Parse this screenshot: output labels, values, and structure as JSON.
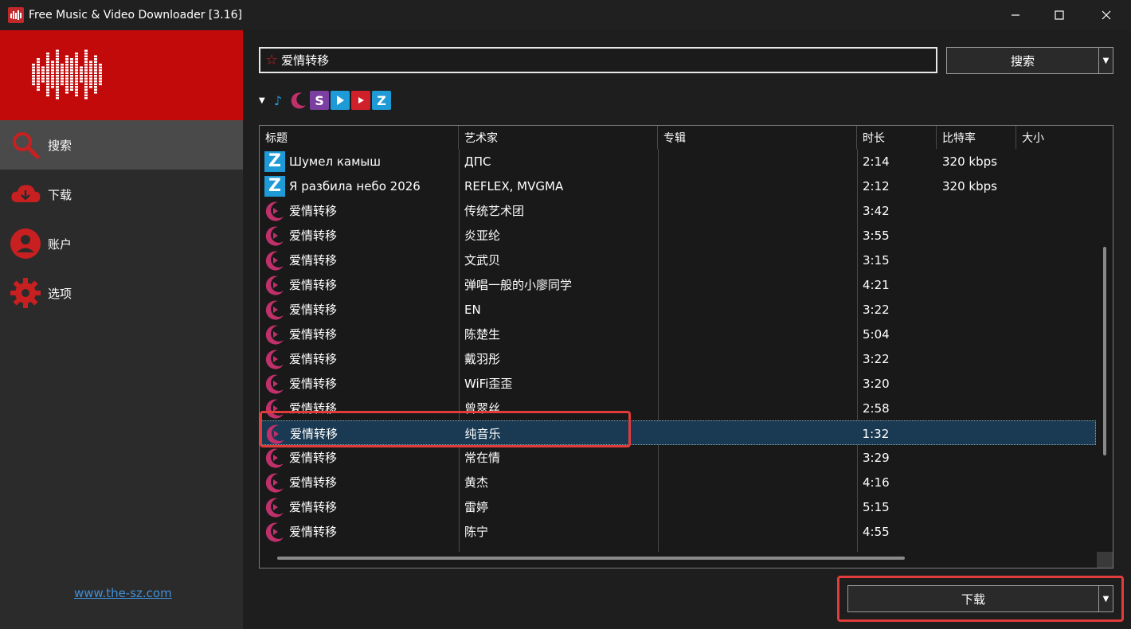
{
  "window": {
    "title": "Free Music & Video Downloader [3.16]",
    "minimize": "—",
    "maximize": "☐",
    "close": "✕"
  },
  "sidebar": {
    "items": [
      {
        "label": "搜索",
        "icon": "search-icon",
        "active": true
      },
      {
        "label": "下载",
        "icon": "cloud-download-icon",
        "active": false
      },
      {
        "label": "账户",
        "icon": "user-icon",
        "active": false
      },
      {
        "label": "选项",
        "icon": "gear-icon",
        "active": false
      }
    ],
    "link": "www.the-sz.com"
  },
  "search": {
    "query": "爱情转移",
    "button_label": "搜索"
  },
  "sources": [
    "music-note-icon",
    "moon-icon",
    "s-icon",
    "play-icon",
    "youtube-icon",
    "z-icon"
  ],
  "table": {
    "headers": [
      "标题",
      "艺术家",
      "专辑",
      "时长",
      "比特率",
      "大小"
    ],
    "rows": [
      {
        "icon": "z",
        "title": "Шумел камыш",
        "artist": "ДПС",
        "album": "",
        "duration": "2:14",
        "bitrate": "320 kbps",
        "size": ""
      },
      {
        "icon": "z",
        "title": "Я разбила небо 2026",
        "artist": "REFLEX, MVGMA",
        "album": "",
        "duration": "2:12",
        "bitrate": "320 kbps",
        "size": ""
      },
      {
        "icon": "moon",
        "title": "爱情转移",
        "artist": "传统艺术团",
        "album": "",
        "duration": "3:42",
        "bitrate": "",
        "size": ""
      },
      {
        "icon": "moon",
        "title": "爱情转移",
        "artist": "炎亚纶",
        "album": "",
        "duration": "3:55",
        "bitrate": "",
        "size": ""
      },
      {
        "icon": "moon",
        "title": "爱情转移",
        "artist": "文武贝",
        "album": "",
        "duration": "3:15",
        "bitrate": "",
        "size": ""
      },
      {
        "icon": "moon",
        "title": "爱情转移",
        "artist": "弹唱一般的小廖同学",
        "album": "",
        "duration": "4:21",
        "bitrate": "",
        "size": ""
      },
      {
        "icon": "moon",
        "title": "爱情转移",
        "artist": "EN",
        "album": "",
        "duration": "3:22",
        "bitrate": "",
        "size": ""
      },
      {
        "icon": "moon",
        "title": "爱情转移",
        "artist": "陈楚生",
        "album": "",
        "duration": "5:04",
        "bitrate": "",
        "size": ""
      },
      {
        "icon": "moon",
        "title": "爱情转移",
        "artist": "戴羽彤",
        "album": "",
        "duration": "3:22",
        "bitrate": "",
        "size": ""
      },
      {
        "icon": "moon",
        "title": "爱情转移",
        "artist": "WiFi歪歪",
        "album": "",
        "duration": "3:20",
        "bitrate": "",
        "size": ""
      },
      {
        "icon": "moon",
        "title": "爱情转移",
        "artist": "曾翠丝",
        "album": "",
        "duration": "2:58",
        "bitrate": "",
        "size": ""
      },
      {
        "icon": "moon",
        "title": "爱情转移",
        "artist": "纯音乐",
        "album": "",
        "duration": "1:32",
        "bitrate": "",
        "size": "",
        "selected": true
      },
      {
        "icon": "moon",
        "title": "爱情转移",
        "artist": "常在情",
        "album": "",
        "duration": "3:29",
        "bitrate": "",
        "size": ""
      },
      {
        "icon": "moon",
        "title": "爱情转移",
        "artist": "黄杰",
        "album": "",
        "duration": "4:16",
        "bitrate": "",
        "size": ""
      },
      {
        "icon": "moon",
        "title": "爱情转移",
        "artist": "雷婷",
        "album": "",
        "duration": "5:15",
        "bitrate": "",
        "size": ""
      },
      {
        "icon": "moon",
        "title": "爱情转移",
        "artist": "陈宁",
        "album": "",
        "duration": "4:55",
        "bitrate": "",
        "size": ""
      }
    ]
  },
  "download": {
    "button_label": "下载"
  },
  "colors": {
    "accent_red": "#c20a0a",
    "highlight": "#e23b3b",
    "selected_row": "#1a3a54",
    "z_blue": "#1e9ad6",
    "moon_pink": "#c0306a"
  }
}
